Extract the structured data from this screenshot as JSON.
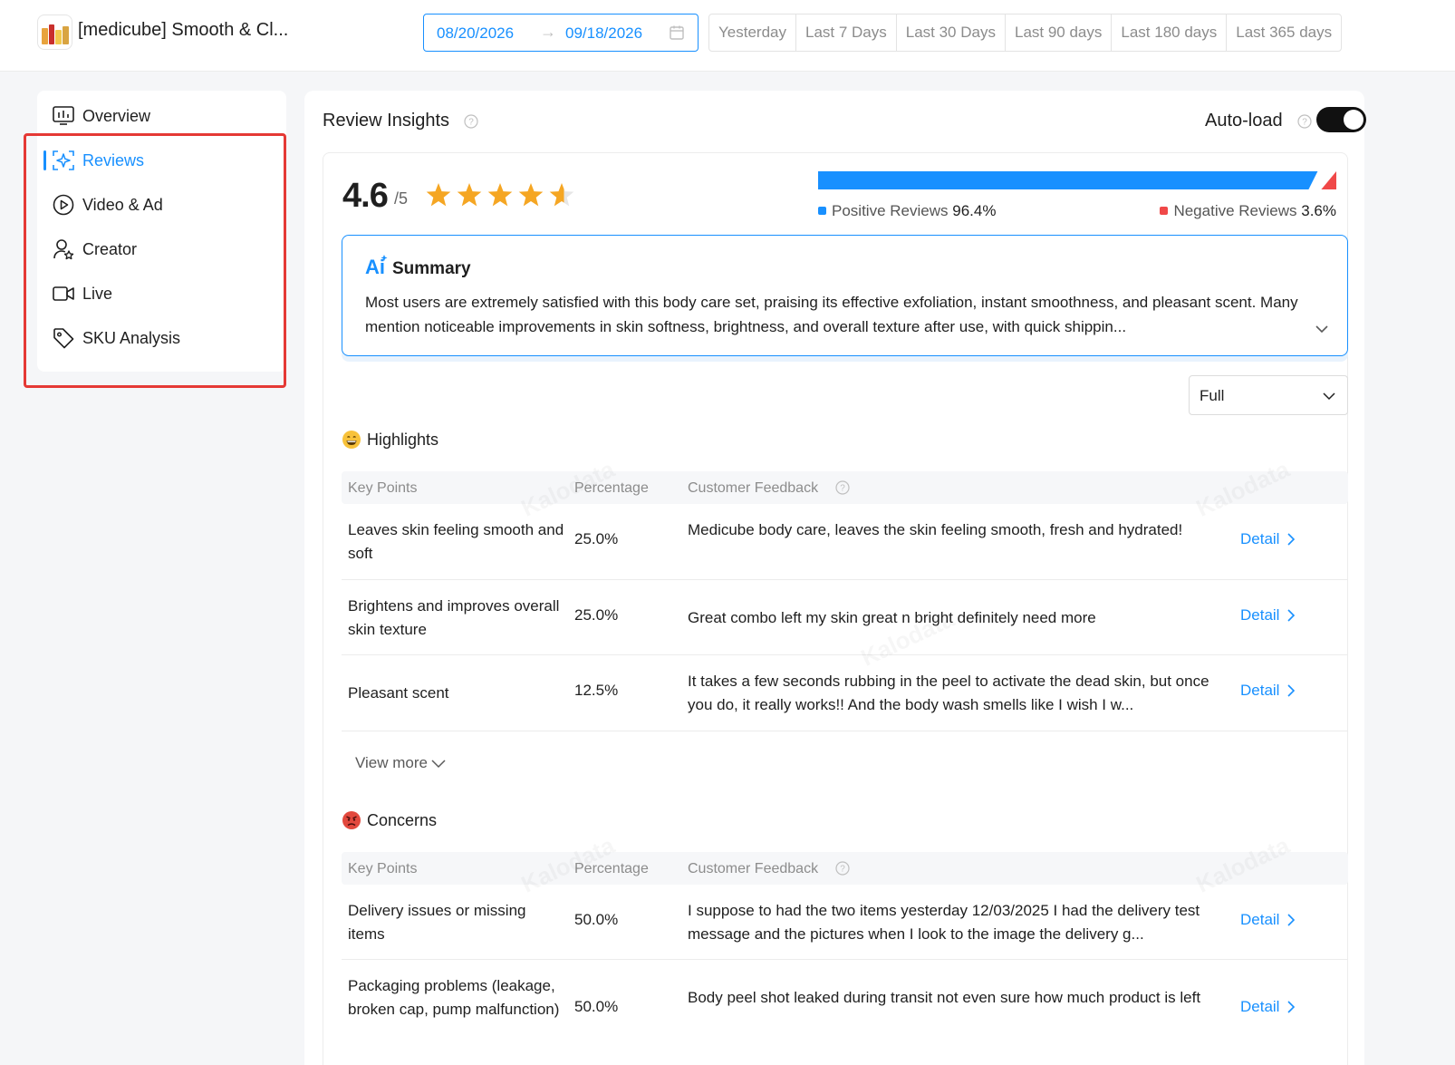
{
  "header": {
    "product_title": "[medicube] Smooth & Cl...",
    "date_start": "08/20/2026",
    "date_arrow": "→",
    "date_end": "09/18/2026",
    "quick_ranges": [
      "Yesterday",
      "Last 7 Days",
      "Last 30 Days",
      "Last 90 days",
      "Last 180 days",
      "Last 365 days"
    ]
  },
  "sidebar": {
    "items": [
      {
        "label": "Overview",
        "icon": "chart-icon"
      },
      {
        "label": "Reviews",
        "icon": "ai-sparkle-icon",
        "active": true
      },
      {
        "label": "Video & Ad",
        "icon": "play-icon"
      },
      {
        "label": "Creator",
        "icon": "user-star-icon"
      },
      {
        "label": "Live",
        "icon": "video-camera-icon"
      },
      {
        "label": "SKU Analysis",
        "icon": "tag-icon"
      }
    ]
  },
  "main": {
    "title": "Review Insights",
    "autoload_label": "Auto-load",
    "autoload_on": true,
    "rating": {
      "score": "4.6",
      "out_of": "/5",
      "stars": 4.6
    },
    "sentiment": {
      "positive_label": "Positive Reviews",
      "positive_value": "96.4%",
      "positive_pct": 96.4,
      "negative_label": "Negative Reviews",
      "negative_value": "3.6%",
      "negative_pct": 3.6,
      "positive_color": "#1890ff",
      "negative_color": "#f04848"
    },
    "summary": {
      "title": "Summary",
      "text": "Most users are extremely satisfied with this body care set, praising its effective exfoliation, instant smoothness, and pleasant scent. Many mention noticeable improvements in skin softness, brightness, and overall texture after use, with quick shippin..."
    },
    "filter_select": "Full",
    "headers": {
      "key_points": "Key Points",
      "percentage": "Percentage",
      "feedback": "Customer Feedback"
    },
    "highlights": {
      "title": "Highlights",
      "rows": [
        {
          "key": "Leaves skin feeling smooth and soft",
          "pct": "25.0%",
          "feedback": "Medicube body care, leaves the skin feeling smooth, fresh and hydrated!",
          "detail": "Detail"
        },
        {
          "key": "Brightens and improves overall skin texture",
          "pct": "25.0%",
          "feedback": "Great combo left my skin great n bright definitely need more",
          "detail": "Detail"
        },
        {
          "key": "Pleasant scent",
          "pct": "12.5%",
          "feedback": "It takes a few seconds rubbing in the peel to activate the dead skin, but once you do, it really works!! And the body wash smells like I wish I w...",
          "detail": "Detail"
        }
      ],
      "view_more": "View more"
    },
    "concerns": {
      "title": "Concerns",
      "rows": [
        {
          "key": "Delivery issues or missing items",
          "pct": "50.0%",
          "feedback": "I suppose to had the two items yesterday 12/03/2025 I had the delivery test message and the pictures when I look to the image the delivery g...",
          "detail": "Detail"
        },
        {
          "key": "Packaging problems (leakage, broken cap, pump malfunction)",
          "pct": "50.0%",
          "feedback": "Body peel shot leaked during transit not even sure how much product is left",
          "detail": "Detail"
        }
      ]
    },
    "watermark": "Kalodata"
  }
}
